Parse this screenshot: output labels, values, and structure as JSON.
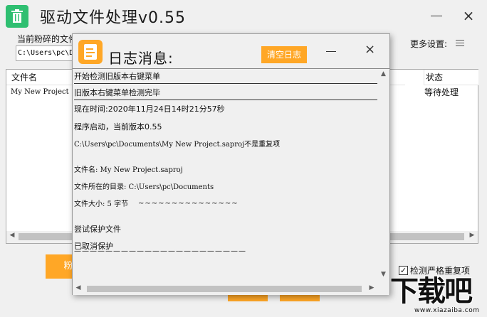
{
  "window": {
    "title": "驱动文件处理v0.55",
    "app_icon": "trash-icon",
    "close_glyph": "×"
  },
  "toolbar": {
    "path_label": "当前粉碎的文件",
    "path_value": "C:\\Users\\pc\\D",
    "more_settings_label": "更多设置:",
    "more_icon": "list-icon"
  },
  "file_table": {
    "columns": [
      "文件名",
      "状态"
    ],
    "rows": [
      {
        "name": "My New Project",
        "status": "等待处理"
      }
    ]
  },
  "actions": {
    "shred_label": "粉",
    "strict_duplicate_label": "检测严格重复项",
    "strict_duplicate_checked": true
  },
  "watermark": {
    "logo_text": "下载吧",
    "url": "www.xiazaiba.com"
  },
  "log_dialog": {
    "title": "日志消息:",
    "clear_label": "清空日志",
    "close_glyph": "×",
    "lines": [
      "开始检测旧版本右键菜单",
      "旧版本右键菜单检测完毕",
      "现在时间:2020年11月24日14时21分57秒",
      "程序启动，当前版本0.55",
      "C:\\Users\\pc\\Documents\\My New Project.saproj不是重复项",
      "文件名: My New Project.saproj",
      "文件所在的目录: C:\\Users\\pc\\Documents",
      "文件大小: 5 字节",
      "尝试保护文件",
      "已取消保护"
    ],
    "dash_line": "——————————————————————",
    "wavy_tail": "~~~~~~~~~~~~~~~"
  },
  "colors": {
    "accent_orange": "#ffa726",
    "app_icon_green": "#2fbf71"
  }
}
